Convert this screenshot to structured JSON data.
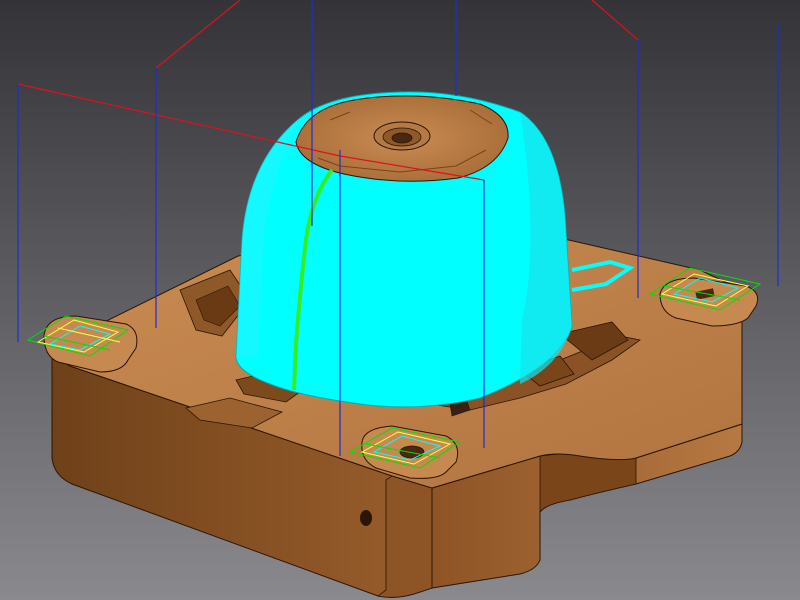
{
  "viewport": {
    "type": "3d-cad-cam-viewport",
    "background": {
      "top": "#333338",
      "bottom": "#8a8a8e"
    }
  },
  "model": {
    "part": "mold-block-with-dome-core",
    "colors": {
      "block_top": "#c0824a",
      "block_side_dark": "#7e4c22",
      "block_side_light": "#a3652f",
      "edge": "#2a1506",
      "selected_surface": "#00ffff",
      "selected_surface_shade": "#19d8e2"
    }
  },
  "overlay": {
    "toolpath_plunge_color": "#1a2fd6",
    "toolpath_rapid_color": "#e0101e",
    "toolpath_cut_color": "#33ee22",
    "pad_pattern_colors": [
      "#00e000",
      "#ffff44",
      "#00ffff"
    ]
  }
}
